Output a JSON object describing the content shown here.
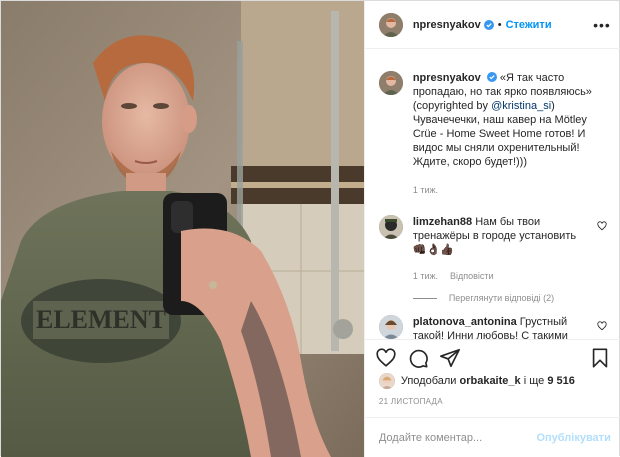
{
  "header": {
    "username": "npresnyakov",
    "dot": "•",
    "follow_label": "Стежити",
    "more_label": "•••"
  },
  "caption": {
    "username": "npresnyakov",
    "text_lines": [
      "«Я так часто",
      "пропадаю, но так ярко появляюсь»",
      "(copyrighted by @kristina_si)",
      "Чувачечечки, наш кавер на Mötley",
      "Crüe - Home Sweet Home готов! И",
      "видос мы сняли охренительный!",
      "Ждите, скоро будет!)))"
    ],
    "time": "1 тиж."
  },
  "comments": [
    {
      "username": "limzehan88",
      "text_lines": [
        "Нам бы твои",
        "тренажёры в городе установить",
        "👊🏿👌🏿👍🏿"
      ],
      "time": "1 тиж.",
      "reply_label": "Відповісти",
      "view_replies_label": "Переглянути відповіді (2)"
    },
    {
      "username": "platonova_antonina",
      "text_lines": [
        "Грустный",
        "такой! Инни любовь! С такими"
      ],
      "time": "",
      "reply_label": ""
    }
  ],
  "likes": {
    "prefix": "Уподобали",
    "user": "orbakaite_k",
    "suffix": "і ще",
    "count": "9 516"
  },
  "date": "21 ЛИСТОПАДА",
  "add_comment": {
    "placeholder": "Додайте коментар...",
    "publish_label": "Опублікувати"
  },
  "icons": {
    "like": "heart-icon",
    "comment": "comment-icon",
    "share": "share-icon",
    "save": "bookmark-icon",
    "verified": "verified-badge-icon",
    "more": "more-options-icon"
  },
  "colors": {
    "link": "#0095f6",
    "publish_disabled": "#b2dffc",
    "secondary_text": "#8e8e8e",
    "verified": "#3897f0"
  }
}
